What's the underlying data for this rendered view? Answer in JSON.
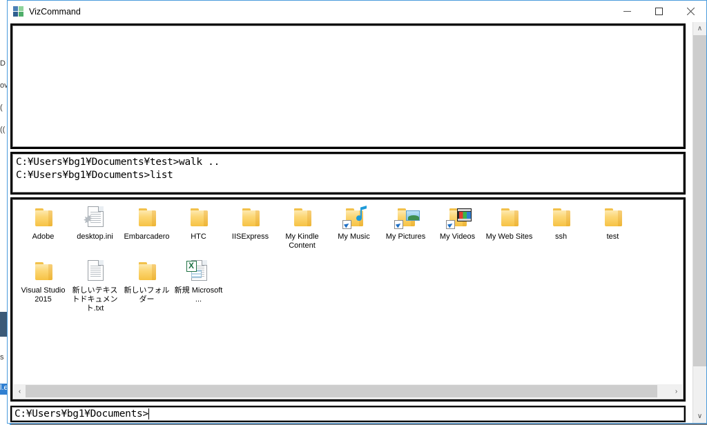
{
  "window": {
    "title": "VizCommand",
    "app_icon": "vizcommand-icon",
    "controls": {
      "minimize": "minimize-button",
      "maximize": "maximize-button",
      "close": "close-button"
    },
    "accent_color": "#4a9bdc"
  },
  "output_pane": {
    "text": ""
  },
  "history_pane": {
    "lines": [
      "C:¥Users¥bg1¥Documents¥test>walk ..",
      "C:¥Users¥bg1¥Documents>list"
    ],
    "text": "C:¥Users¥bg1¥Documents¥test>walk ..\nC:¥Users¥bg1¥Documents>list"
  },
  "files_pane": {
    "items": [
      {
        "label": "Adobe",
        "icon": "folder-icon",
        "kind": "folder"
      },
      {
        "label": "desktop.ini",
        "icon": "ini-file-icon",
        "kind": "file-gear"
      },
      {
        "label": "Embarcadero",
        "icon": "folder-icon",
        "kind": "folder"
      },
      {
        "label": "HTC",
        "icon": "folder-icon",
        "kind": "folder"
      },
      {
        "label": "IISExpress",
        "icon": "folder-icon",
        "kind": "folder"
      },
      {
        "label": "My Kindle Content",
        "icon": "folder-icon",
        "kind": "folder"
      },
      {
        "label": "My Music",
        "icon": "music-folder-icon",
        "kind": "folder-music-shortcut"
      },
      {
        "label": "My Pictures",
        "icon": "pictures-folder-icon",
        "kind": "folder-pictures-shortcut"
      },
      {
        "label": "My Videos",
        "icon": "videos-folder-icon",
        "kind": "folder-videos-shortcut"
      },
      {
        "label": "My Web Sites",
        "icon": "folder-icon",
        "kind": "folder"
      },
      {
        "label": "ssh",
        "icon": "folder-icon",
        "kind": "folder"
      },
      {
        "label": "test",
        "icon": "folder-icon",
        "kind": "folder"
      },
      {
        "label": "Visual Studio 2015",
        "icon": "folder-icon",
        "kind": "folder"
      },
      {
        "label": "新しいテキストドキュメント.txt",
        "icon": "text-file-icon",
        "kind": "file-text"
      },
      {
        "label": "新しいフォルダー",
        "icon": "folder-icon",
        "kind": "folder"
      },
      {
        "label": "新規 Microsoft ...",
        "icon": "excel-file-icon",
        "kind": "file-excel"
      }
    ],
    "hscroll": {
      "left_arrow": "‹",
      "right_arrow": "›"
    }
  },
  "input_line": {
    "prompt": "C:¥Users¥bg1¥Documents>",
    "value": "",
    "placeholder": ""
  },
  "vscroll": {
    "up_arrow": "∧",
    "down_arrow": "∨"
  },
  "background_window": {
    "fragments": [
      "D",
      "ov",
      "(",
      "((",
      "s",
      "l.e"
    ]
  }
}
